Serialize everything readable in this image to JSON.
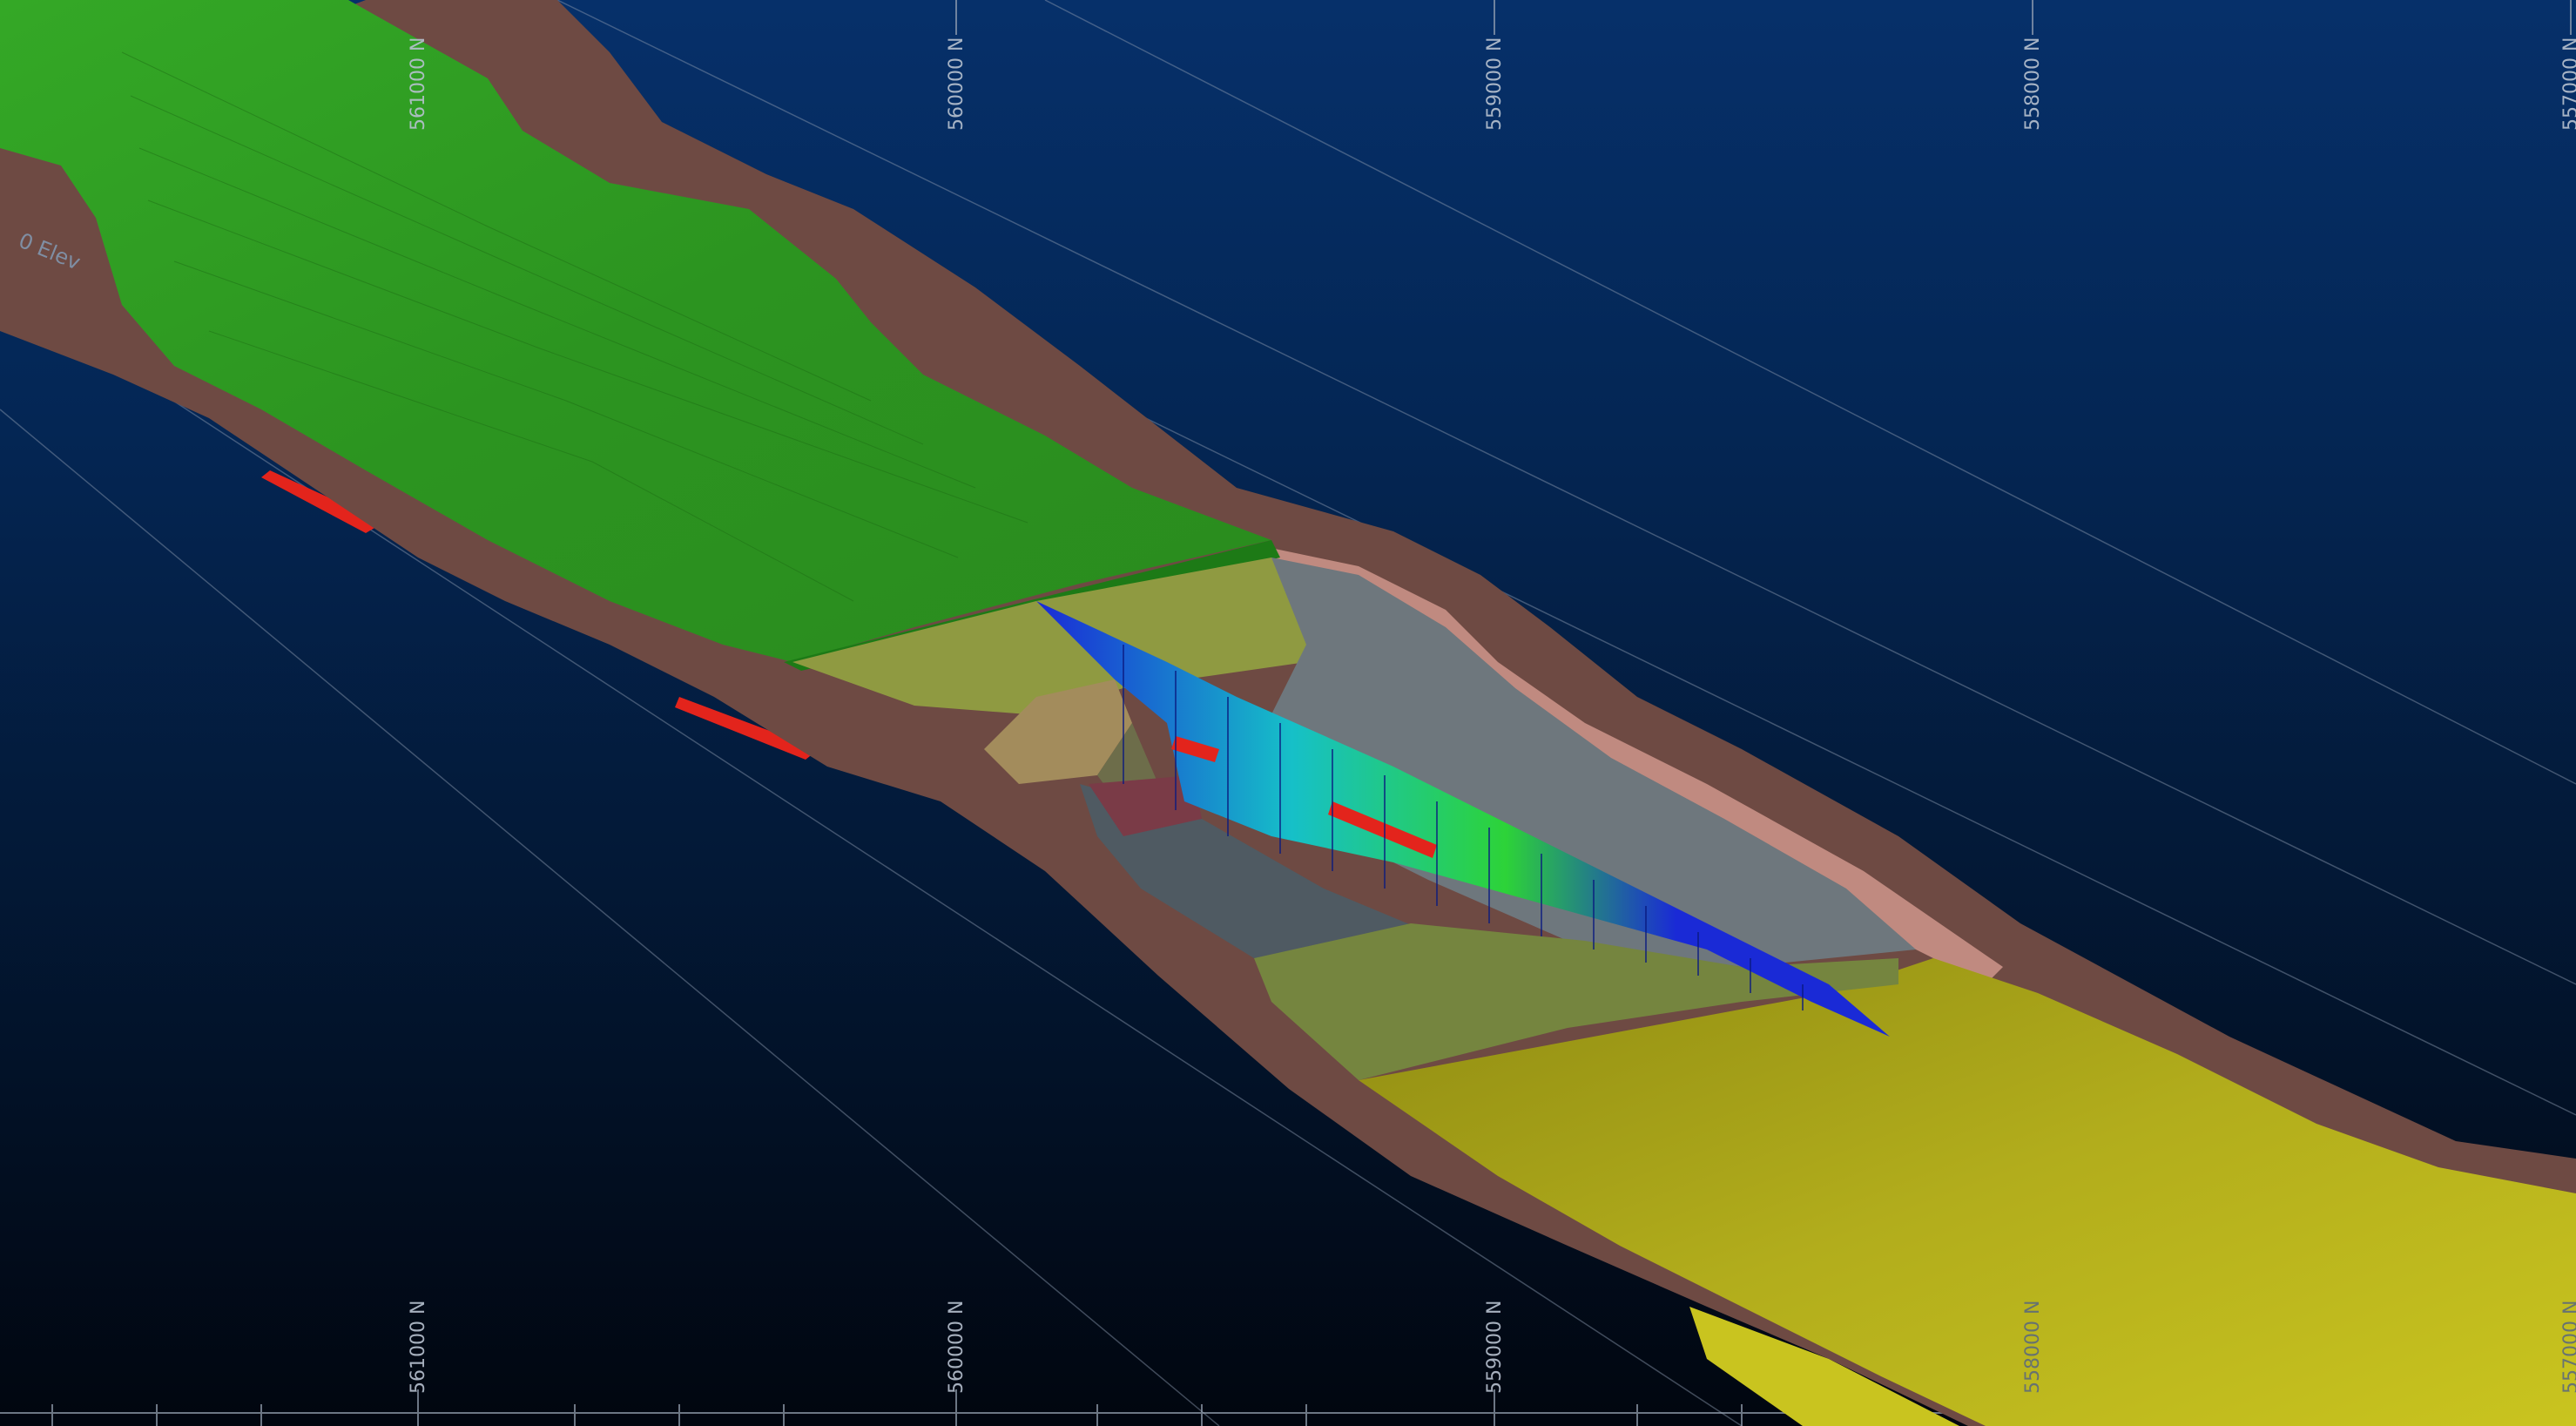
{
  "viewer": {
    "elevation_label": "0 Elev",
    "grid_northings_top": [
      "561000 N",
      "560000 N",
      "559000 N",
      "558000 N",
      "557000 N"
    ],
    "grid_northings_bottom": [
      "561000 N",
      "560000 N",
      "559000 N",
      "558000 N",
      "557000 N"
    ]
  },
  "colors": {
    "background_top": "#06306a",
    "background_bottom": "#01060f",
    "casing": "#6e4a43",
    "casing_light": "#c08a80",
    "green_surface": "#2f9a23",
    "yellow_surface": "#b6b21c",
    "olive": "#7d8c45",
    "grey_pit": "#6e777d",
    "section_blue": "#1a2ad6",
    "anomaly_red": "#e3241c"
  },
  "icons": [
    "grid-tick",
    "section-plane",
    "block-model"
  ]
}
